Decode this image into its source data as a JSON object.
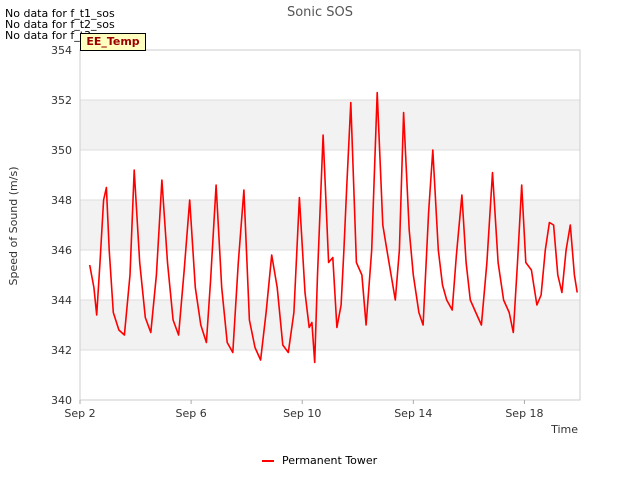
{
  "chart_data": {
    "type": "line",
    "title": "Sonic SOS",
    "xlabel": "Time",
    "ylabel": "Speed of Sound (m/s)",
    "ylim": [
      340,
      354
    ],
    "yticks": [
      340,
      342,
      344,
      346,
      348,
      350,
      352,
      354
    ],
    "xticks": [
      {
        "day": 2,
        "label": "Sep 2"
      },
      {
        "day": 6,
        "label": "Sep 6"
      },
      {
        "day": 10,
        "label": "Sep 10"
      },
      {
        "day": 14,
        "label": "Sep 14"
      },
      {
        "day": 18,
        "label": "Sep 18"
      }
    ],
    "xlim_days": [
      2,
      20
    ],
    "grid": true,
    "legend_position": "bottom-center",
    "series": [
      {
        "name": "Permanent Tower",
        "color": "#ff0000",
        "x_days": [
          2.35,
          2.5,
          2.6,
          2.72,
          2.85,
          2.95,
          3.05,
          3.2,
          3.4,
          3.6,
          3.8,
          3.95,
          4.15,
          4.35,
          4.55,
          4.75,
          4.95,
          5.15,
          5.35,
          5.55,
          5.75,
          5.95,
          6.15,
          6.35,
          6.55,
          6.7,
          6.9,
          7.1,
          7.3,
          7.5,
          7.7,
          7.9,
          8.1,
          8.3,
          8.5,
          8.7,
          8.9,
          9.1,
          9.3,
          9.5,
          9.7,
          9.9,
          10.1,
          10.25,
          10.35,
          10.45,
          10.55,
          10.75,
          10.95,
          11.1,
          11.25,
          11.4,
          11.5,
          11.6,
          11.75,
          11.95,
          12.15,
          12.3,
          12.5,
          12.7,
          12.9,
          13.05,
          13.2,
          13.35,
          13.5,
          13.65,
          13.85,
          14.0,
          14.2,
          14.35,
          14.55,
          14.7,
          14.9,
          15.05,
          15.2,
          15.4,
          15.55,
          15.75,
          15.9,
          16.05,
          16.25,
          16.45,
          16.65,
          16.85,
          17.05,
          17.25,
          17.45,
          17.6,
          17.75,
          17.9,
          18.05,
          18.25,
          18.45,
          18.6,
          18.75,
          18.9,
          19.05,
          19.2,
          19.35,
          19.5,
          19.65,
          19.8,
          19.9
        ],
        "values": [
          345.4,
          344.5,
          343.4,
          345.5,
          348.0,
          348.5,
          346.0,
          343.5,
          342.8,
          342.6,
          345.0,
          349.2,
          345.5,
          343.3,
          342.7,
          345.0,
          348.8,
          345.5,
          343.2,
          342.6,
          345.2,
          348.0,
          344.5,
          343.0,
          342.3,
          344.8,
          348.6,
          344.5,
          342.3,
          341.9,
          345.5,
          348.4,
          343.2,
          342.1,
          341.6,
          343.5,
          345.8,
          344.5,
          342.2,
          341.9,
          343.5,
          348.1,
          344.3,
          342.9,
          343.1,
          341.5,
          345.0,
          350.6,
          345.5,
          345.7,
          342.9,
          343.8,
          346.0,
          348.5,
          351.9,
          345.5,
          345.0,
          343.0,
          346.0,
          352.3,
          347.0,
          346.0,
          345.0,
          344.0,
          346.0,
          351.5,
          346.8,
          345.0,
          343.5,
          343.0,
          347.5,
          350.0,
          346.0,
          344.6,
          344.0,
          343.6,
          345.8,
          348.2,
          345.5,
          344.0,
          343.5,
          343.0,
          345.5,
          349.1,
          345.5,
          344.0,
          343.5,
          342.7,
          345.5,
          348.6,
          345.5,
          345.2,
          343.8,
          344.2,
          346.0,
          347.1,
          347.0,
          345.0,
          344.3,
          346.0,
          347.0,
          345.0,
          344.3
        ]
      }
    ],
    "annotations": [
      "No data for f_t1_sos",
      "No data for f_t2_sos",
      "No data for f_t3_sos"
    ],
    "tag": "EE_Temp"
  }
}
